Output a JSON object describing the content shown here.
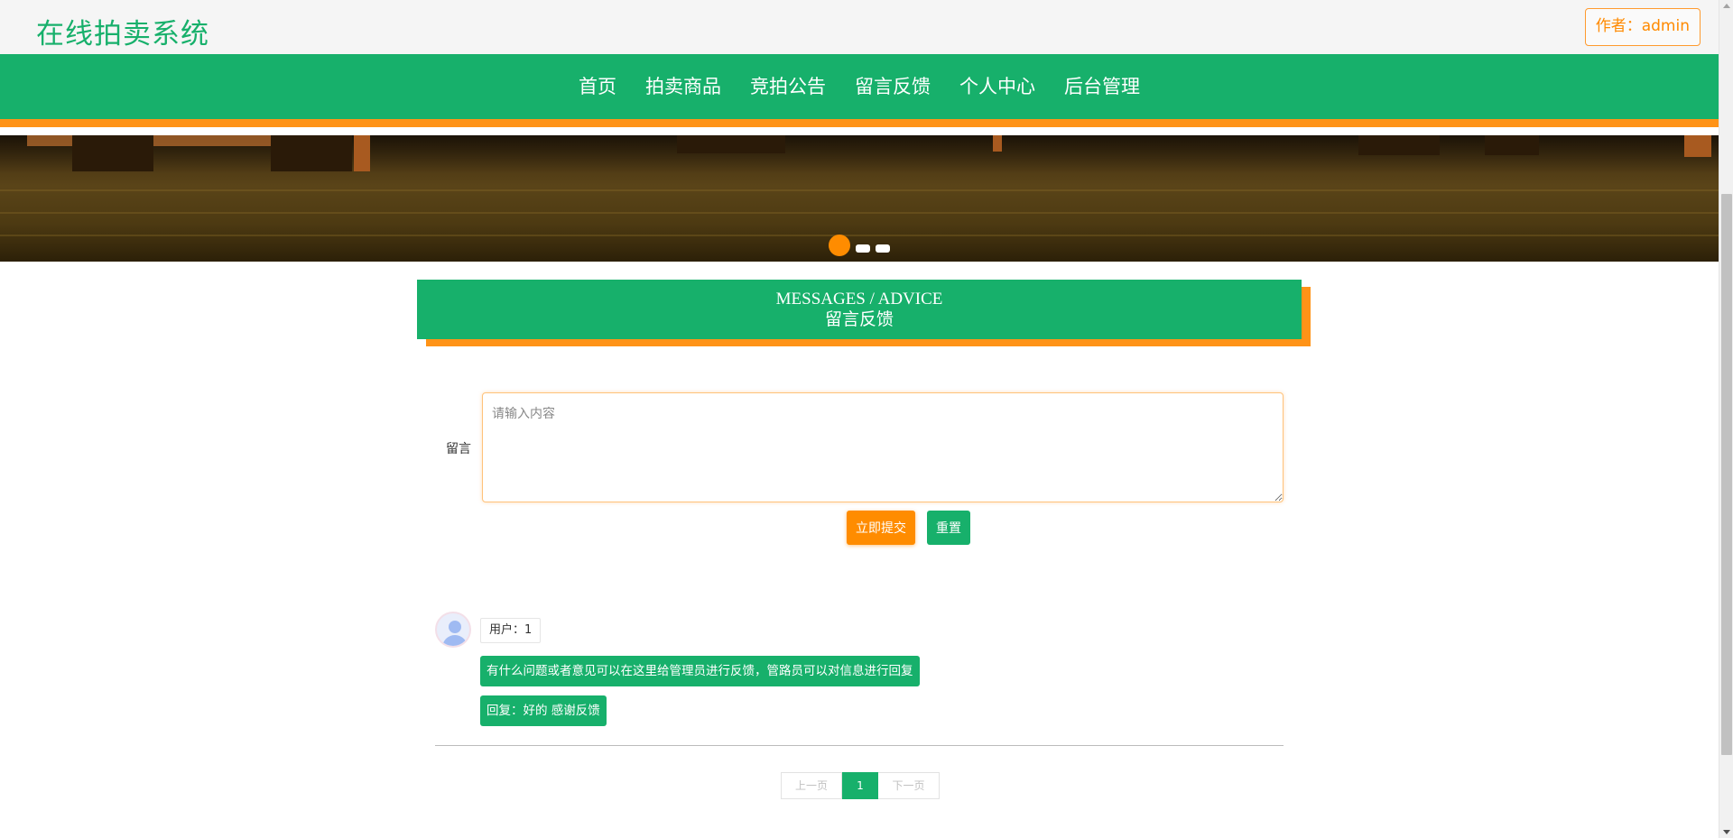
{
  "header": {
    "site_title": "在线拍卖系统",
    "author_badge": "作者：admin"
  },
  "nav": {
    "items": [
      {
        "label": "首页"
      },
      {
        "label": "拍卖商品"
      },
      {
        "label": "竞拍公告"
      },
      {
        "label": "留言反馈"
      },
      {
        "label": "个人中心"
      },
      {
        "label": "后台管理"
      }
    ]
  },
  "banner": {
    "slide_count": 3,
    "active_slide": 1
  },
  "section": {
    "title_en": "MESSAGES / ADVICE",
    "title_cn": "留言反馈"
  },
  "form": {
    "label": "留言",
    "placeholder": "请输入内容",
    "value": "",
    "submit_label": "立即提交",
    "reset_label": "重置"
  },
  "messages": [
    {
      "user": "用户：1",
      "content": "有什么问题或者意见可以在这里给管理员进行反馈，管路员可以对信息进行回复",
      "reply": "回复：好的 感谢反馈"
    }
  ],
  "pagination": {
    "prev_label": "上一页",
    "current_page": "1",
    "next_label": "下一页"
  },
  "colors": {
    "primary_green": "#17b06b",
    "accent_orange": "#ff9317"
  }
}
